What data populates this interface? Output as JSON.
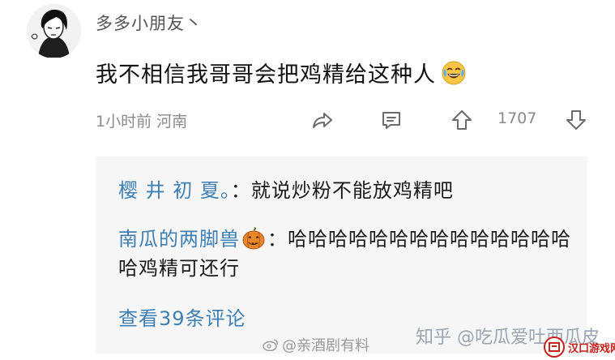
{
  "comment": {
    "username": "多多小朋友丶",
    "text": "我不相信我哥哥会把鸡精给这种人",
    "emoji": "laughing-crying-emoji",
    "time_location": "1小时前 河南",
    "votes": "1707"
  },
  "replies": [
    {
      "author": "樱 井 初 夏。",
      "separator": "：",
      "text": "就说炒粉不能放鸡精吧"
    },
    {
      "author": "南瓜的两脚兽",
      "author_emoji": "pumpkin-icon",
      "separator": "：",
      "text": "哈哈哈哈哈哈哈哈哈哈哈哈哈哈哈鸡精可还行"
    }
  ],
  "view_all": "查看39条评论",
  "watermarks": {
    "weibo": "@亲酒剧有料",
    "zhihu": "知乎 @吃瓜爱吐西瓜皮",
    "site": "汉口游戏网"
  },
  "colors": {
    "reply_author": "#3e7fb4",
    "link": "#3e7fb4",
    "meta": "#8a8a8a",
    "reply_bg": "#f6f6f6"
  }
}
